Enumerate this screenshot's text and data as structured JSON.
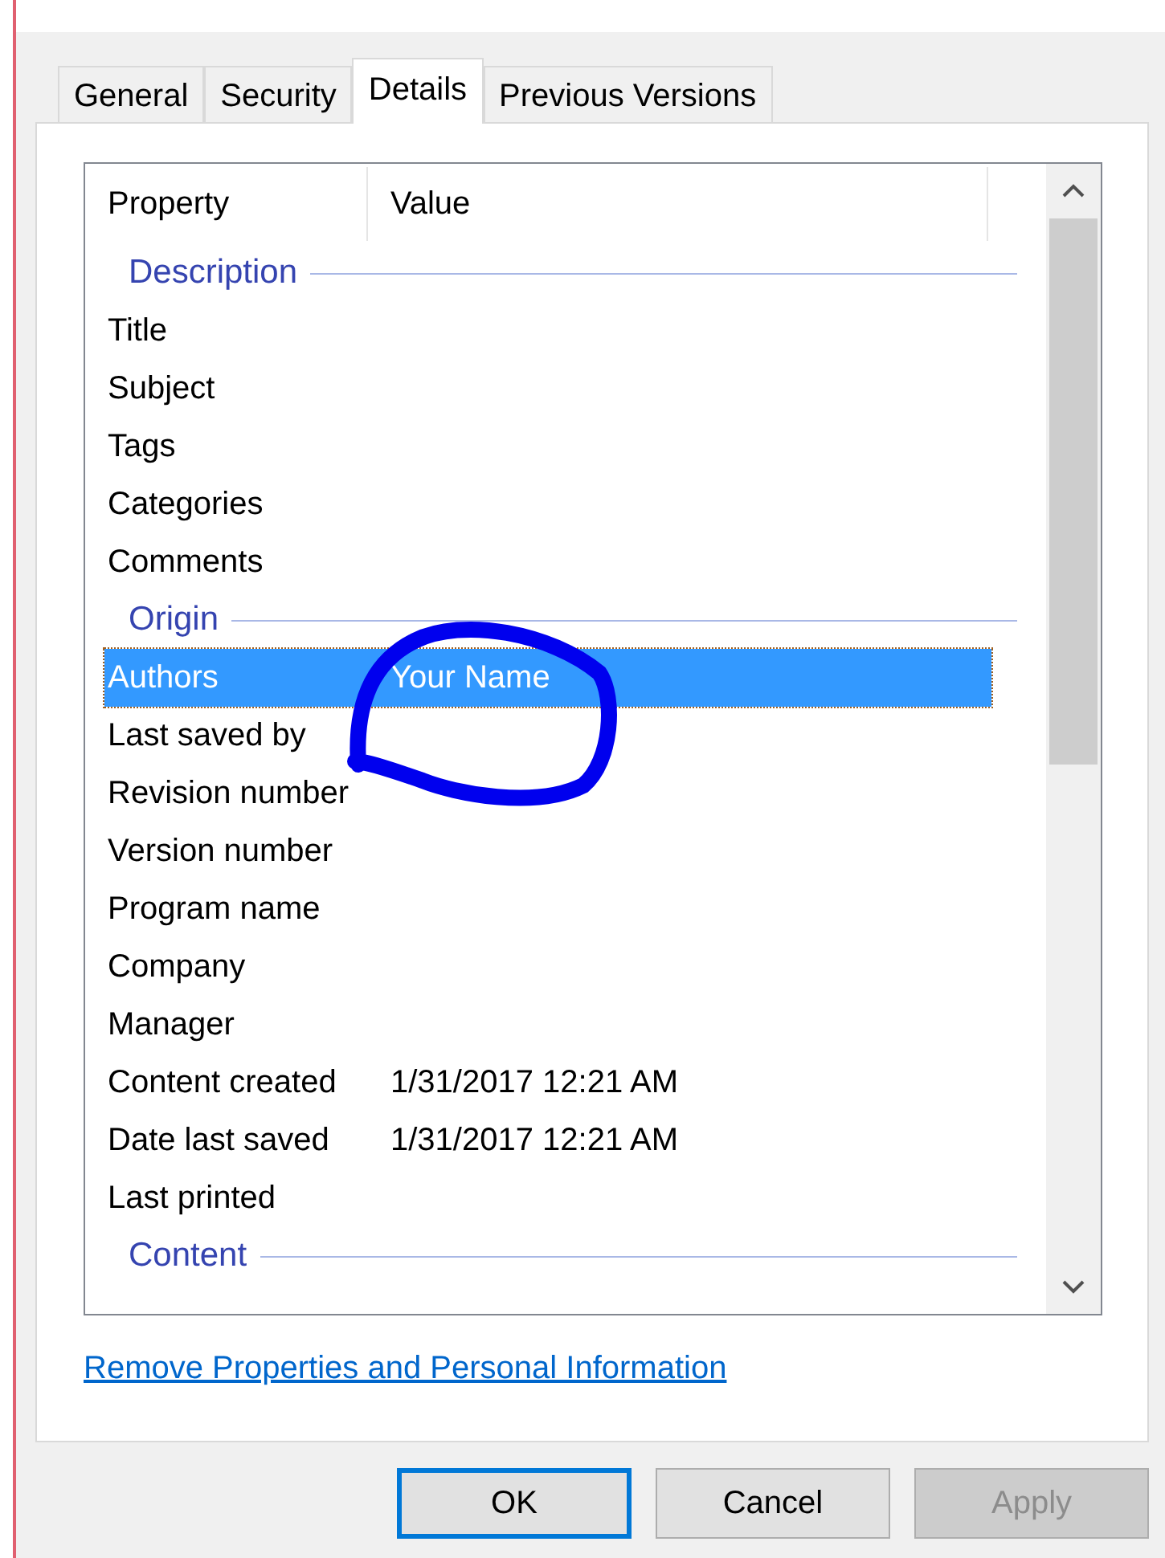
{
  "tabs": [
    {
      "label": "General",
      "selected": false
    },
    {
      "label": "Security",
      "selected": false
    },
    {
      "label": "Details",
      "selected": true
    },
    {
      "label": "Previous Versions",
      "selected": false
    }
  ],
  "list": {
    "columns": [
      "Property",
      "Value"
    ],
    "rows": [
      {
        "kind": "group",
        "label": "Description"
      },
      {
        "kind": "property",
        "name": "Title",
        "selected": false
      },
      {
        "kind": "property",
        "name": "Subject",
        "selected": false
      },
      {
        "kind": "property",
        "name": "Tags",
        "selected": false
      },
      {
        "kind": "property",
        "name": "Categories",
        "selected": false
      },
      {
        "kind": "property",
        "name": "Comments",
        "selected": false
      },
      {
        "kind": "group",
        "label": "Origin"
      },
      {
        "kind": "property",
        "name": "Authors",
        "value": "Your Name",
        "selected": true
      },
      {
        "kind": "property",
        "name": "Last saved by",
        "selected": false
      },
      {
        "kind": "property",
        "name": "Revision number",
        "selected": false
      },
      {
        "kind": "property",
        "name": "Version number",
        "selected": false
      },
      {
        "kind": "property",
        "name": "Program name",
        "selected": false
      },
      {
        "kind": "property",
        "name": "Company",
        "selected": false
      },
      {
        "kind": "property",
        "name": "Manager",
        "selected": false
      },
      {
        "kind": "property",
        "name": "Content created",
        "value": "1/31/2017 12:21 AM",
        "selected": false
      },
      {
        "kind": "property",
        "name": "Date last saved",
        "value": "1/31/2017 12:21 AM",
        "selected": false
      },
      {
        "kind": "property",
        "name": "Last printed",
        "selected": false
      },
      {
        "kind": "group",
        "label": "Content"
      }
    ]
  },
  "link": "Remove Properties and Personal Information",
  "buttons": [
    {
      "label": "OK",
      "default": true,
      "disabled": false
    },
    {
      "label": "Cancel",
      "default": false,
      "disabled": false
    },
    {
      "label": "Apply",
      "default": false,
      "disabled": true
    }
  ]
}
